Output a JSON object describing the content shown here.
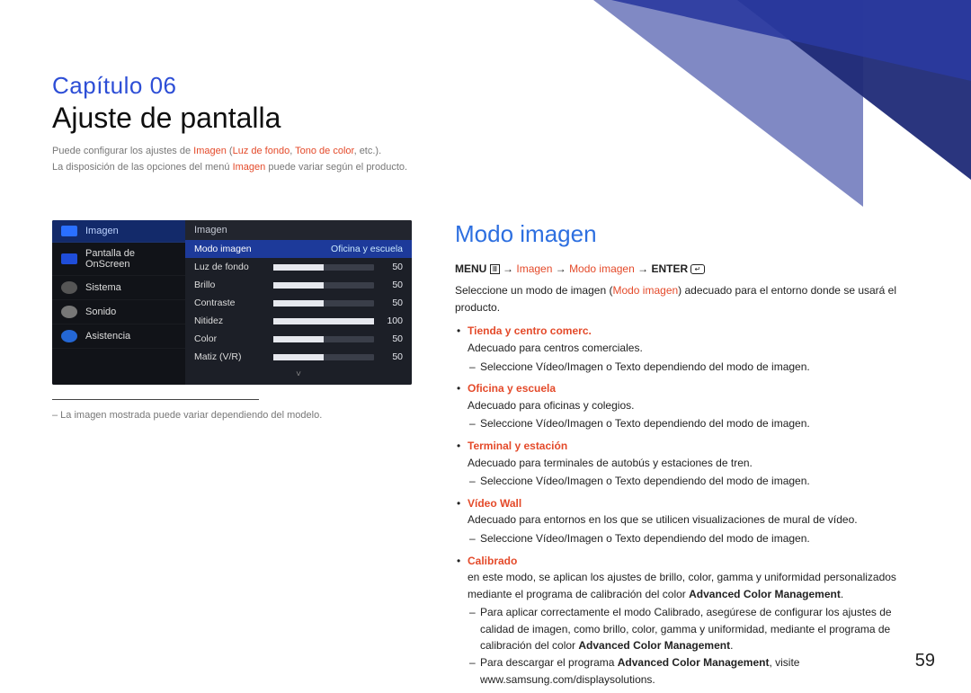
{
  "chapter": {
    "num": "Capítulo 06",
    "title": "Ajuste de pantalla"
  },
  "intro": {
    "l1_a": "Puede configurar los ajustes de ",
    "l1_b": "Imagen",
    "l1_c": " (",
    "l1_d": "Luz de fondo",
    "l1_e": ", ",
    "l1_f": "Tono de color",
    "l1_g": ", etc.).",
    "l2_a": "La disposición de las opciones del menú ",
    "l2_b": "Imagen",
    "l2_c": " puede variar según el producto."
  },
  "osd": {
    "left": [
      {
        "label": "Imagen"
      },
      {
        "label": "Pantalla de OnScreen"
      },
      {
        "label": "Sistema"
      },
      {
        "label": "Sonido"
      },
      {
        "label": "Asistencia"
      }
    ],
    "header": "Imagen",
    "rows": [
      {
        "label": "Modo imagen",
        "text": "Oficina y escuela"
      },
      {
        "label": "Luz de fondo",
        "value": "50",
        "pct": 50
      },
      {
        "label": "Brillo",
        "value": "50",
        "pct": 50
      },
      {
        "label": "Contraste",
        "value": "50",
        "pct": 50
      },
      {
        "label": "Nitidez",
        "value": "100",
        "pct": 100
      },
      {
        "label": "Color",
        "value": "50",
        "pct": 50
      },
      {
        "label": "Matiz (V/R)",
        "value": "50",
        "pct": 50
      }
    ],
    "down": "˅"
  },
  "caption": "– La imagen mostrada puede variar dependiendo del modelo.",
  "section": {
    "title": "Modo imagen"
  },
  "path": {
    "menu": "MENU ",
    "arrow": " → ",
    "imagen": "Imagen",
    "modo": "Modo imagen",
    "enter": " ENTER "
  },
  "desc1_a": "Seleccione un modo de imagen (",
  "desc1_b": "Modo imagen",
  "desc1_c": ") adecuado para el entorno donde se usará el producto.",
  "modes": [
    {
      "name": "Tienda y centro comerc.",
      "body": "Adecuado para centros comerciales.",
      "sub": [
        {
          "a": "Seleccione ",
          "b": "Vídeo/Imagen",
          "c": " o ",
          "d": "Texto",
          "e": " dependiendo del modo de imagen."
        }
      ]
    },
    {
      "name": "Oficina y escuela",
      "body": "Adecuado para oficinas y colegios.",
      "sub": [
        {
          "a": "Seleccione ",
          "b": "Vídeo/Imagen",
          "c": " o ",
          "d": "Texto",
          "e": " dependiendo del modo de imagen."
        }
      ]
    },
    {
      "name": "Terminal y estación",
      "body": "Adecuado para terminales de autobús y estaciones de tren.",
      "sub": [
        {
          "a": "Seleccione ",
          "b": "Vídeo/Imagen",
          "c": " o ",
          "d": "Texto",
          "e": " dependiendo del modo de imagen."
        }
      ]
    },
    {
      "name": "Vídeo Wall",
      "body": "Adecuado para entornos en los que se utilicen visualizaciones de mural de vídeo.",
      "sub": [
        {
          "a": "Seleccione ",
          "b": "Vídeo/Imagen",
          "c": " o ",
          "d": "Texto",
          "e": " dependiendo del modo de imagen."
        }
      ]
    }
  ],
  "calibrado": {
    "name": "Calibrado",
    "body_a": "en este modo, se aplican los ajustes de brillo, color, gamma y uniformidad personalizados mediante el programa de calibración del color ",
    "body_b": "Advanced Color Management",
    "body_c": ".",
    "s1_a": "Para aplicar correctamente el modo ",
    "s1_b": "Calibrado",
    "s1_c": ", asegúrese de configurar los ajustes de calidad de imagen, como brillo, color, gamma y uniformidad, mediante el programa de calibración del color ",
    "s1_d": "Advanced Color Management",
    "s1_e": ".",
    "s2_a": "Para descargar el programa ",
    "s2_b": "Advanced Color Management",
    "s2_c": ", visite www.samsung.com/displaysolutions."
  },
  "page": "59"
}
